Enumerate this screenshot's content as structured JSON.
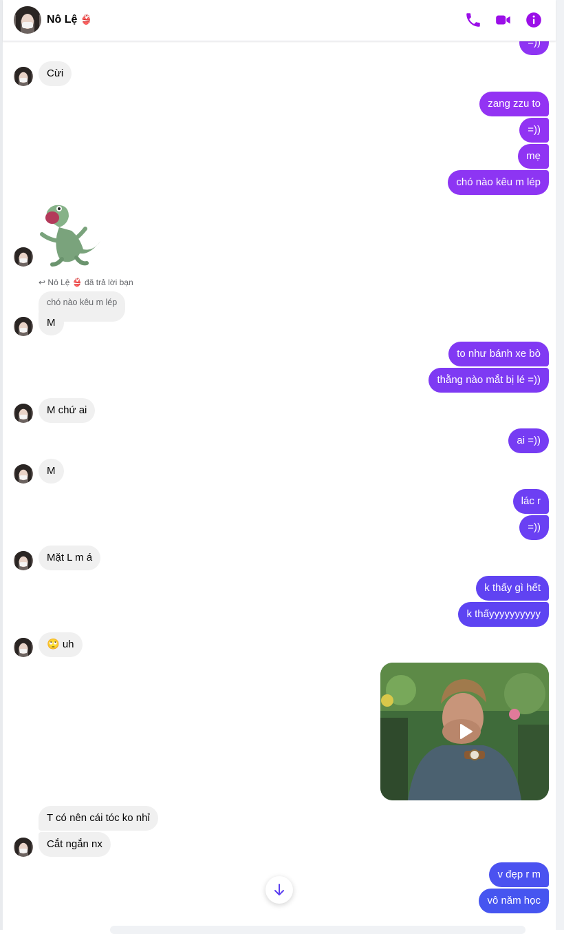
{
  "header": {
    "contact_name": "Nô Lệ",
    "name_emoji": "👙"
  },
  "sticker": {
    "name": "gecko-sticker"
  },
  "reply": {
    "note": "Nô Lệ 👙 đã trả lời bạn",
    "quoted": "chó nào kêu m lép"
  },
  "messages": [
    {
      "from": "me",
      "text": "=))"
    },
    {
      "from": "them",
      "text": "Cừi"
    },
    {
      "from": "me",
      "text": "zang zzu to"
    },
    {
      "from": "me",
      "text": "=))"
    },
    {
      "from": "me",
      "text": "mẹ"
    },
    {
      "from": "me",
      "text": "chó nào kêu m lép"
    },
    {
      "from": "them",
      "text": "M"
    },
    {
      "from": "me",
      "text": "to như bánh xe bò"
    },
    {
      "from": "me",
      "text": "thằng nào mắt bị lé =))"
    },
    {
      "from": "them",
      "text": "M chứ ai"
    },
    {
      "from": "me",
      "text": "ai =))"
    },
    {
      "from": "them",
      "text": "M"
    },
    {
      "from": "me",
      "text": "lác r"
    },
    {
      "from": "me",
      "text": "=))"
    },
    {
      "from": "them",
      "text": "Mặt L m á"
    },
    {
      "from": "me",
      "text": "k thấy gì hết"
    },
    {
      "from": "me",
      "text": "k thấyyyyyyyyyy"
    },
    {
      "from": "them",
      "text": "🙄 uh"
    },
    {
      "from": "them",
      "text": "T có nên cái tóc ko nhỉ"
    },
    {
      "from": "them",
      "text": "Cắt ngắn nx"
    },
    {
      "from": "me",
      "text": "v đẹp r m"
    },
    {
      "from": "me",
      "text": "vô năm học"
    }
  ],
  "colors": {
    "accent": "#9b0fe8",
    "gradient_top": "#9333f3",
    "gradient_bottom": "#4b52f0",
    "incoming": "#f0f0f0"
  }
}
